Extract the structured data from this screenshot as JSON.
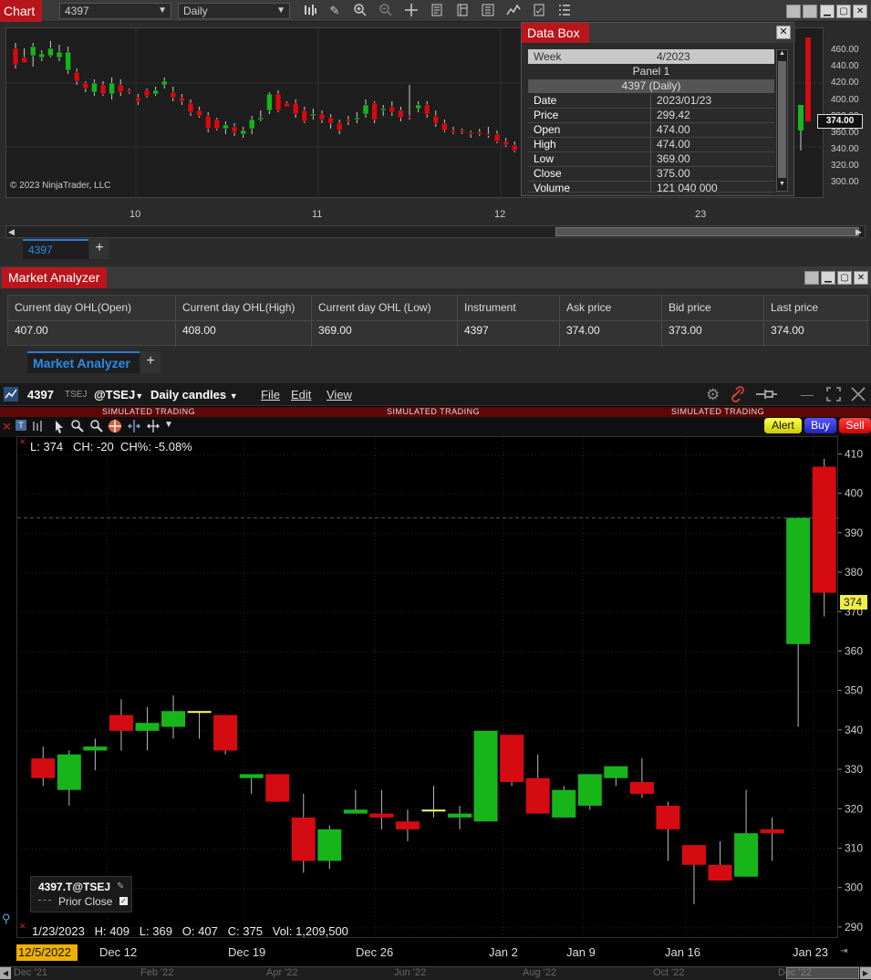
{
  "nt": {
    "tab": "Chart",
    "instrument": "4397",
    "interval": "Daily",
    "copyright": "© 2023 NinjaTrader, LLC",
    "x_labels": [
      "10",
      "11",
      "12",
      "23"
    ],
    "y_labels": [
      "460.00",
      "440.00",
      "420.00",
      "400.00",
      "380.00",
      "360.00",
      "340.00",
      "320.00",
      "300.00"
    ],
    "last_price_tag": "374.00",
    "tab_name": "4397",
    "add_tab": "+"
  },
  "databox": {
    "title": "Data Box",
    "week_label": "Week",
    "week_value": "4/2023",
    "panel": "Panel 1",
    "series": "4397 (Daily)",
    "rows": [
      {
        "k": "Date",
        "v": "2023/01/23"
      },
      {
        "k": "Price",
        "v": "299.42"
      },
      {
        "k": "Open",
        "v": "474.00"
      },
      {
        "k": "High",
        "v": "474.00"
      },
      {
        "k": "Low",
        "v": "369.00"
      },
      {
        "k": "Close",
        "v": "375.00"
      },
      {
        "k": "Volume",
        "v": "121 040 000"
      }
    ]
  },
  "ma": {
    "title": "Market Analyzer",
    "columns": [
      {
        "h": "Current day OHL(Open)",
        "v": "407.00"
      },
      {
        "h": "Current day OHL(High)",
        "v": "408.00"
      },
      {
        "h": "Current day OHL (Low)",
        "v": "369.00"
      },
      {
        "h": "Instrument",
        "v": "4397"
      },
      {
        "h": "Ask price",
        "v": "374.00"
      },
      {
        "h": "Bid price",
        "v": "373.00"
      },
      {
        "h": "Last price",
        "v": "374.00"
      }
    ],
    "tab_name": "Market Analyzer",
    "add_tab": "+"
  },
  "tws": {
    "symbol": "4397",
    "exchange_small": "TSEJ",
    "exchange": "@TSEJ",
    "chart_type": "Daily candles",
    "menu": [
      "File",
      "Edit",
      "View"
    ],
    "sim_text": "SIMULATED TRADING",
    "buttons": {
      "alert": "Alert",
      "buy": "Buy",
      "sell": "Sell"
    },
    "info_line": "L: 374   CH: -20  CH%: -5.08%",
    "legend_title": "4397.T@TSEJ",
    "legend_item": "Prior Close",
    "ohlc_line": "1/23/2023   H: 409   L: 369   O: 407   C: 375   Vol: 1,209,500",
    "y_labels": [
      "410",
      "400",
      "390",
      "380",
      "370",
      "360",
      "350",
      "340",
      "330",
      "320",
      "310",
      "300",
      "290"
    ],
    "price_tag": "374",
    "x_first": "12/5/2022",
    "x_labels": [
      "Dec 12",
      "Dec 19",
      "Dec 26",
      "Jan 2",
      "Jan 9",
      "Jan 16",
      "Jan 23"
    ],
    "bottom_labels": [
      "Dec '21",
      "Feb '22",
      "Apr '22",
      "Jun '22",
      "Aug '22",
      "Oct '22",
      "Dec '22"
    ],
    "colors": {
      "up": "#17b51a",
      "down": "#d40b10",
      "flat": "#ffff66"
    }
  },
  "chart_data": [
    {
      "type": "candlestick",
      "title": "",
      "ylim": [
        290,
        410
      ],
      "y_ticks": [
        410,
        400,
        390,
        380,
        370,
        360,
        350,
        340,
        330,
        320,
        310,
        300,
        290
      ],
      "x_tick_labels": [
        "12/5/2022",
        "Dec 12",
        "Dec 19",
        "Dec 26",
        "Jan 2",
        "Jan 9",
        "Jan 16",
        "Jan 23"
      ],
      "prior_close": 394,
      "last": 374,
      "candles": [
        {
          "o": 333,
          "h": 336,
          "l": 326,
          "c": 328
        },
        {
          "o": 325,
          "h": 335,
          "l": 321,
          "c": 334
        },
        {
          "o": 335,
          "h": 338,
          "l": 330,
          "c": 336
        },
        {
          "o": 344,
          "h": 348,
          "l": 335,
          "c": 340
        },
        {
          "o": 340,
          "h": 346,
          "l": 335,
          "c": 342
        },
        {
          "o": 341,
          "h": 349,
          "l": 338,
          "c": 345
        },
        {
          "o": 345,
          "h": 345,
          "l": 338,
          "c": 345
        },
        {
          "o": 344,
          "h": 344,
          "l": 334,
          "c": 335
        },
        {
          "o": 328,
          "h": 328,
          "l": 324,
          "c": 329
        },
        {
          "o": 329,
          "h": 329,
          "l": 322,
          "c": 322
        },
        {
          "o": 318,
          "h": 324,
          "l": 304,
          "c": 307
        },
        {
          "o": 307,
          "h": 316,
          "l": 305,
          "c": 315
        },
        {
          "o": 319,
          "h": 325,
          "l": 319,
          "c": 320
        },
        {
          "o": 319,
          "h": 325,
          "l": 315,
          "c": 318
        },
        {
          "o": 317,
          "h": 320,
          "l": 312,
          "c": 315
        },
        {
          "o": 320,
          "h": 326,
          "l": 318,
          "c": 320
        },
        {
          "o": 318,
          "h": 321,
          "l": 315,
          "c": 319
        },
        {
          "o": 317,
          "h": 340,
          "l": 317,
          "c": 340
        },
        {
          "o": 339,
          "h": 339,
          "l": 326,
          "c": 327
        },
        {
          "o": 328,
          "h": 334,
          "l": 319,
          "c": 319
        },
        {
          "o": 318,
          "h": 326,
          "l": 318,
          "c": 325
        },
        {
          "o": 321,
          "h": 329,
          "l": 320,
          "c": 329
        },
        {
          "o": 328,
          "h": 331,
          "l": 326,
          "c": 331
        },
        {
          "o": 327,
          "h": 333,
          "l": 323,
          "c": 324
        },
        {
          "o": 321,
          "h": 322,
          "l": 307,
          "c": 315
        },
        {
          "o": 311,
          "h": 311,
          "l": 296,
          "c": 306
        },
        {
          "o": 306,
          "h": 312,
          "l": 302,
          "c": 302
        },
        {
          "o": 303,
          "h": 325,
          "l": 303,
          "c": 314
        },
        {
          "o": 315,
          "h": 318,
          "l": 307,
          "c": 314
        },
        {
          "o": 362,
          "h": 394,
          "l": 341,
          "c": 394
        },
        {
          "o": 407,
          "h": 409,
          "l": 369,
          "c": 375
        }
      ]
    }
  ]
}
